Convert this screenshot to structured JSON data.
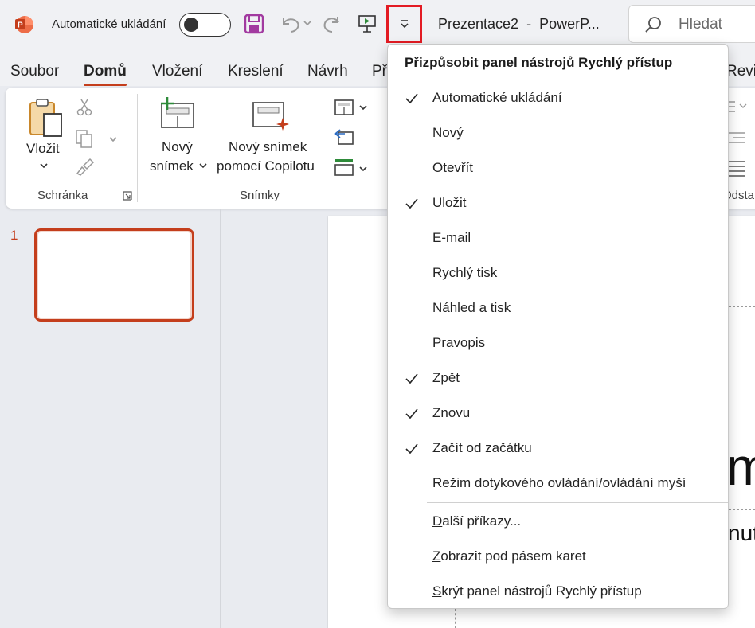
{
  "titlebar": {
    "autosave_label": "Automatické ukládání",
    "autosave_state": "off",
    "document_title": "Prezentace2  -  PowerP...",
    "search_placeholder": "Hledat",
    "qa_icons": [
      "save-icon",
      "undo-icon",
      "redo-icon",
      "present-from-start-icon",
      "customize-toolbar-icon"
    ]
  },
  "tabs": [
    "Soubor",
    "Domů",
    "Vložení",
    "Kreslení",
    "Návrh",
    "Př",
    "Revi"
  ],
  "active_tab": "Domů",
  "ribbon": {
    "paste_label": "Vložit",
    "clipboard_group": "Schránka",
    "new_slide_label_1": "Nový",
    "new_slide_label_2": "snímek",
    "copilot_label_1": "Nový snímek",
    "copilot_label_2": "pomocí Copilotu",
    "slides_group": "Snímky",
    "paragraph_group_partial": "Odsta"
  },
  "slide_panel": {
    "slide_number": "1"
  },
  "canvas": {
    "title_fragment": "m",
    "subtitle_fragment": "nut"
  },
  "accent_color": "#c43e1c",
  "highlight_color": "#e31b23",
  "qa_menu": {
    "header": "Přizpůsobit panel nástrojů Rychlý přístup",
    "items": [
      {
        "label": "Automatické ukládání",
        "checked": true
      },
      {
        "label": "Nový",
        "checked": false
      },
      {
        "label": "Otevřít",
        "checked": false
      },
      {
        "label": "Uložit",
        "checked": true
      },
      {
        "label": "E-mail",
        "checked": false
      },
      {
        "label": "Rychlý tisk",
        "checked": false
      },
      {
        "label": "Náhled a tisk",
        "checked": false
      },
      {
        "label": "Pravopis",
        "checked": false
      },
      {
        "label": "Zpět",
        "checked": true
      },
      {
        "label": "Znovu",
        "checked": true
      },
      {
        "label": "Začít od začátku",
        "checked": true
      },
      {
        "label": "Režim dotykového ovládání/ovládání myší",
        "checked": false
      }
    ],
    "extra_items": [
      {
        "label": "Další příkazy...",
        "mnemonic": "D"
      },
      {
        "label": "Zobrazit pod pásem karet",
        "mnemonic": "Z"
      },
      {
        "label": "Skrýt panel nástrojů Rychlý přístup",
        "mnemonic": "S"
      }
    ]
  }
}
